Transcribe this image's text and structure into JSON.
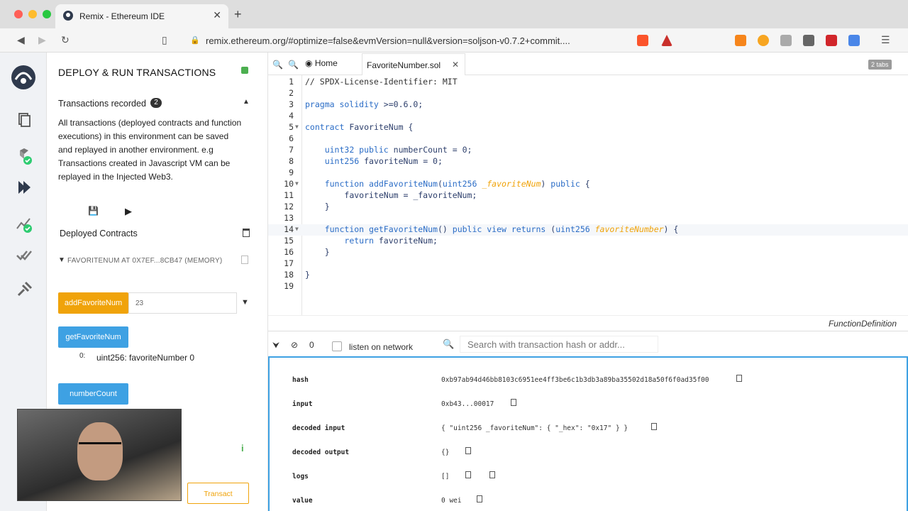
{
  "browser": {
    "tab_title": "Remix - Ethereum IDE",
    "url": "remix.ethereum.org/#optimize=false&evmVersion=null&version=soljson-v0.7.2+commit...."
  },
  "side_panel": {
    "title": "DEPLOY & RUN TRANSACTIONS",
    "recorded_label": "Transactions recorded",
    "recorded_count": "2",
    "recorded_description": "All transactions (deployed contracts and function executions) in this environment can be saved and replayed in another environment. e.g Transactions created in Javascript VM can be replayed in the Injected Web3.",
    "deployed_label": "Deployed Contracts",
    "instance_name": "FAVORITENUM AT 0X7EF...8CB47 (MEMORY)",
    "functions": [
      {
        "label": "addFavoriteNum",
        "kind": "transact",
        "input_value": "23"
      },
      {
        "label": "getFavoriteNum",
        "kind": "call"
      },
      {
        "label": "numberCount",
        "kind": "call"
      }
    ],
    "result_index": "0:",
    "result_value": "uint256: favoriteNumber 0",
    "transact_label": "Transact"
  },
  "editor": {
    "home_tab": "Home",
    "file_tab": "FavoriteNumber.sol",
    "tabs_count": "2 tabs",
    "status": "FunctionDefinition"
  },
  "terminal": {
    "pending_count": "0",
    "listen_label": "listen on network",
    "search_placeholder": "Search with transaction hash or addr...",
    "rows": [
      {
        "key": "hash",
        "value": "0xb97ab94d46bb8103c6951ee4ff3be6c1b3db3a89ba35502d18a50f6f0ad35f00"
      },
      {
        "key": "input",
        "value": "0xb43...00017"
      },
      {
        "key": "decoded input",
        "value": "{ \"uint256 _favoriteNum\": { \"_hex\": \"0x17\" } }"
      },
      {
        "key": "decoded output",
        "value": "{}"
      },
      {
        "key": "logs",
        "value": "[]"
      },
      {
        "key": "value",
        "value": "0 wei"
      }
    ]
  },
  "colors": {
    "transact_orange": "#f0a30a",
    "call_blue": "#3ea1e3",
    "keyword_blue": "#2a6cc6"
  }
}
